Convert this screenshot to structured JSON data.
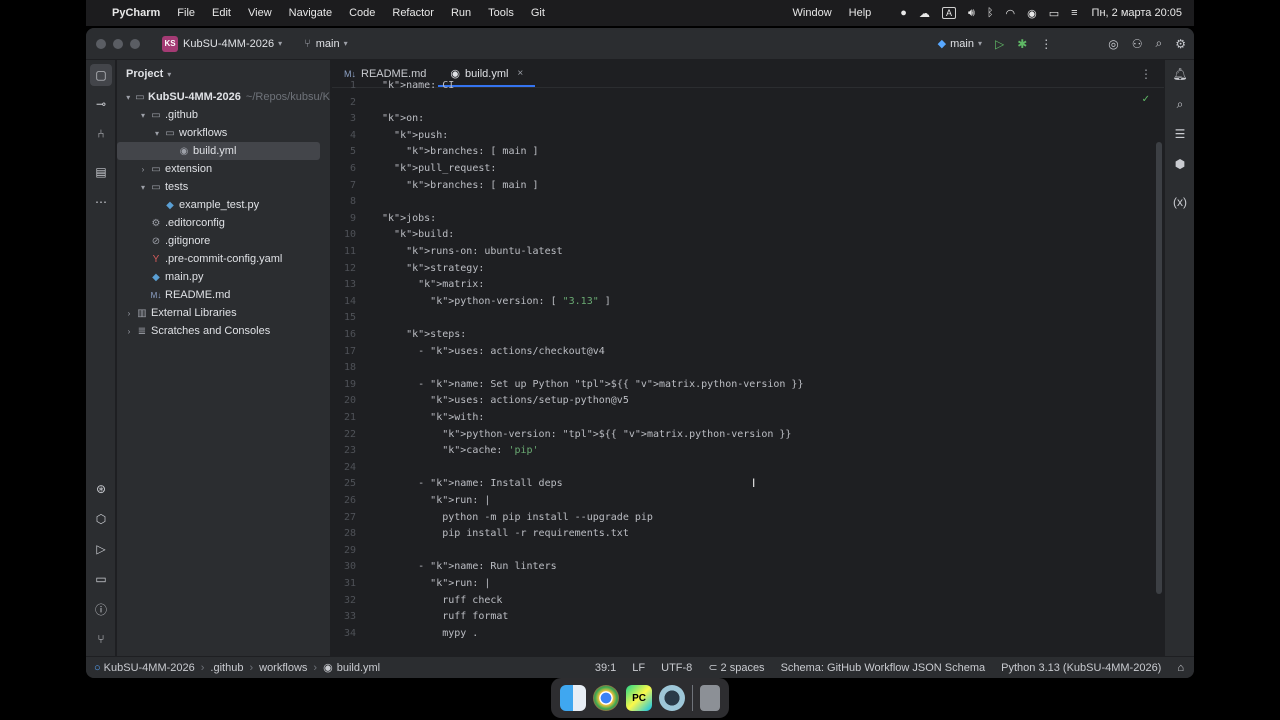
{
  "menubar": {
    "app_name": "PyCharm",
    "menus": [
      "File",
      "Edit",
      "View",
      "Navigate",
      "Code",
      "Refactor",
      "Run",
      "Tools",
      "Git"
    ],
    "right_menus": [
      "Window",
      "Help"
    ],
    "input_indicator": "A",
    "clock": "Пн, 2 марта  20:05"
  },
  "titlebar": {
    "project_badge": "KS",
    "project_name": "KubSU-4MM-2026",
    "branch": "main",
    "run_config": "main"
  },
  "project_panel": {
    "title": "Project",
    "tree": [
      {
        "label": "KubSU-4MM-2026",
        "hint": "~/Repos/kubsu/K",
        "level": 0,
        "expanded": true,
        "type": "folder",
        "bold": true
      },
      {
        "label": ".github",
        "level": 1,
        "expanded": true,
        "type": "folder"
      },
      {
        "label": "workflows",
        "level": 2,
        "expanded": true,
        "type": "folder"
      },
      {
        "label": "build.yml",
        "level": 3,
        "type": "github",
        "selected": true
      },
      {
        "label": "extension",
        "level": 1,
        "expanded": false,
        "type": "folder"
      },
      {
        "label": "tests",
        "level": 1,
        "expanded": true,
        "type": "folder"
      },
      {
        "label": "example_test.py",
        "level": 2,
        "type": "python"
      },
      {
        "label": ".editorconfig",
        "level": 1,
        "type": "gear"
      },
      {
        "label": ".gitignore",
        "level": 1,
        "type": "ignore"
      },
      {
        "label": ".pre-commit-config.yaml",
        "level": 1,
        "type": "yaml"
      },
      {
        "label": "main.py",
        "level": 1,
        "type": "python"
      },
      {
        "label": "README.md",
        "level": 1,
        "type": "markdown"
      },
      {
        "label": "External Libraries",
        "level": 0,
        "expanded": false,
        "type": "library"
      },
      {
        "label": "Scratches and Consoles",
        "level": 0,
        "expanded": false,
        "type": "scratch"
      }
    ]
  },
  "editor": {
    "tabs": [
      {
        "label": "README.md",
        "icon": "M↓",
        "active": false
      },
      {
        "label": "build.yml",
        "icon": "github",
        "active": true
      }
    ],
    "lines": [
      "name: CI",
      "",
      "on:",
      "  push:",
      "    branches: [ main ]",
      "  pull_request:",
      "    branches: [ main ]",
      "",
      "jobs:",
      "  build:",
      "    runs-on: ubuntu-latest",
      "    strategy:",
      "      matrix:",
      "        python-version: [ \"3.13\" ]",
      "",
      "    steps:",
      "      - uses: actions/checkout@v4",
      "",
      "      - name: Set up Python ${{ matrix.python-version }}",
      "        uses: actions/setup-python@v5",
      "        with:",
      "          python-version: ${{ matrix.python-version }}",
      "          cache: 'pip'",
      "",
      "      - name: Install deps",
      "        run: |",
      "          python -m pip install --upgrade pip",
      "          pip install -r requirements.txt",
      "",
      "      - name: Run linters",
      "        run: |",
      "          ruff check",
      "          ruff format",
      "          mypy ."
    ]
  },
  "statusbar": {
    "breadcrumbs": [
      "KubSU-4MM-2026",
      ".github",
      "workflows",
      "build.yml"
    ],
    "position": "39:1",
    "line_ending": "LF",
    "encoding": "UTF-8",
    "indent": "2 spaces",
    "schema": "Schema: GitHub Workflow JSON Schema",
    "interpreter": "Python 3.13 (KubSU-4MM-2026)"
  },
  "colors": {
    "accent": "#3574f0",
    "keyword": "#cf8e6d",
    "string": "#6aab73",
    "success": "#5fb865"
  }
}
